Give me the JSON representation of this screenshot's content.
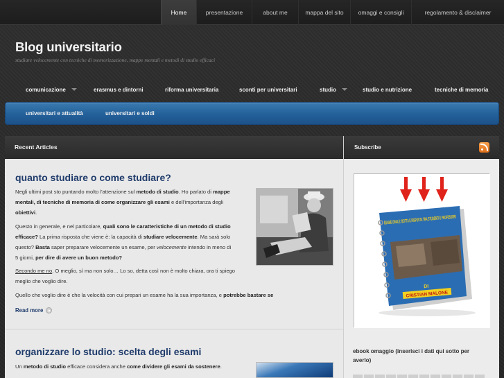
{
  "topnav": {
    "items": [
      {
        "label": "Home",
        "active": true
      },
      {
        "label": "presentazione"
      },
      {
        "label": "about me"
      },
      {
        "label": "mappa del sito"
      },
      {
        "label": "omaggi e consigli"
      },
      {
        "label": "regolamento & disclaimer"
      }
    ]
  },
  "header": {
    "title": "Blog universitario",
    "tagline": "studiare velocemente con tecniche di memorizzazione, mappe mentali e metodi di studio efficaci"
  },
  "catnav": {
    "row1": [
      "comunicazione",
      "erasmus e dintorni",
      "riforma universitaria",
      "sconti per universitari",
      "studio",
      "studio e nutrizione",
      "tecniche di memoria"
    ],
    "row2": [
      "universitari e attualità",
      "universitari e soldi"
    ]
  },
  "main": {
    "section_title": "Recent Articles",
    "read_more": "Read more",
    "post1": {
      "title": "quanto studiare o come studiare?",
      "p1_a": "Negli ultimi post sto puntando molto l'attenzione sul ",
      "p1_b": "metodo di studio",
      "p1_c": ". Ho parlato di ",
      "p1_d": "mappe",
      "p1_e": "mentali, di tecniche di memoria di come organizzare gli esami",
      "p1_f": " e dell'importanza degli",
      "p1_g": "obiettivi",
      "p1_h": ".",
      "p2_a": "Questo in generale, e nel particolare, ",
      "p2_b": "quali sono le caratteristiche di un metodo di studio",
      "p2_c": "efficace?",
      "p2_d": " La prima risposta che viene è: la capacità di ",
      "p2_e": "studiare velocemente",
      "p2_f": ". Ma sarà solo",
      "p2_g": "questo? ",
      "p2_h": "Basta",
      "p2_i": " saper preparare velocemente un esame, per ",
      "p2_j": "velocemente",
      "p2_k": " intendo in meno di",
      "p2_l": "5 giorni, ",
      "p2_m": "per dire di avere un buon metodo?",
      "p3_a": "Secondo me no",
      "p3_b": ". O meglio, sì ma non solo… Lo so, detta così non è molto chiara, ora ti spiego",
      "p3_c": "meglio che voglio dire.",
      "p4_a": "Quello che voglio dire è che la velocità con cui prepari un esame ha la sua importanza, e ",
      "p4_b": "potrebbe bastare se"
    },
    "post2": {
      "title": "organizzare lo studio: scelta degli esami",
      "p1_a": "Un ",
      "p1_b": "metodo di studio",
      "p1_c": " efficace considera anche ",
      "p1_d": "come dividere gli esami da sostenere",
      "p1_e": "."
    }
  },
  "sidebar": {
    "subscribe_title": "Subscribe",
    "ebook_cover_title": "ESAME ORALE: BOTTA E RISPOSTA TRA STUDENTI E PROFESSORI",
    "ebook_author_prefix": "DI",
    "ebook_author": "CRISTIAN MALONE",
    "ebook_widget_title": "ebook omaggio (inserisci i dati qui sotto per avere)",
    "ebook_widget_title_1": "ebook omaggio (inserisci i dati qui sotto per",
    "ebook_widget_title_2": "averlo)",
    "colors": {
      "arrow": "#e0231a",
      "cover": "#2b6db3",
      "accent": "#f2d020"
    }
  },
  "colors": {
    "accent_blue": "#23609a",
    "link": "#1f3b6b",
    "background": "#2a2a2a"
  }
}
